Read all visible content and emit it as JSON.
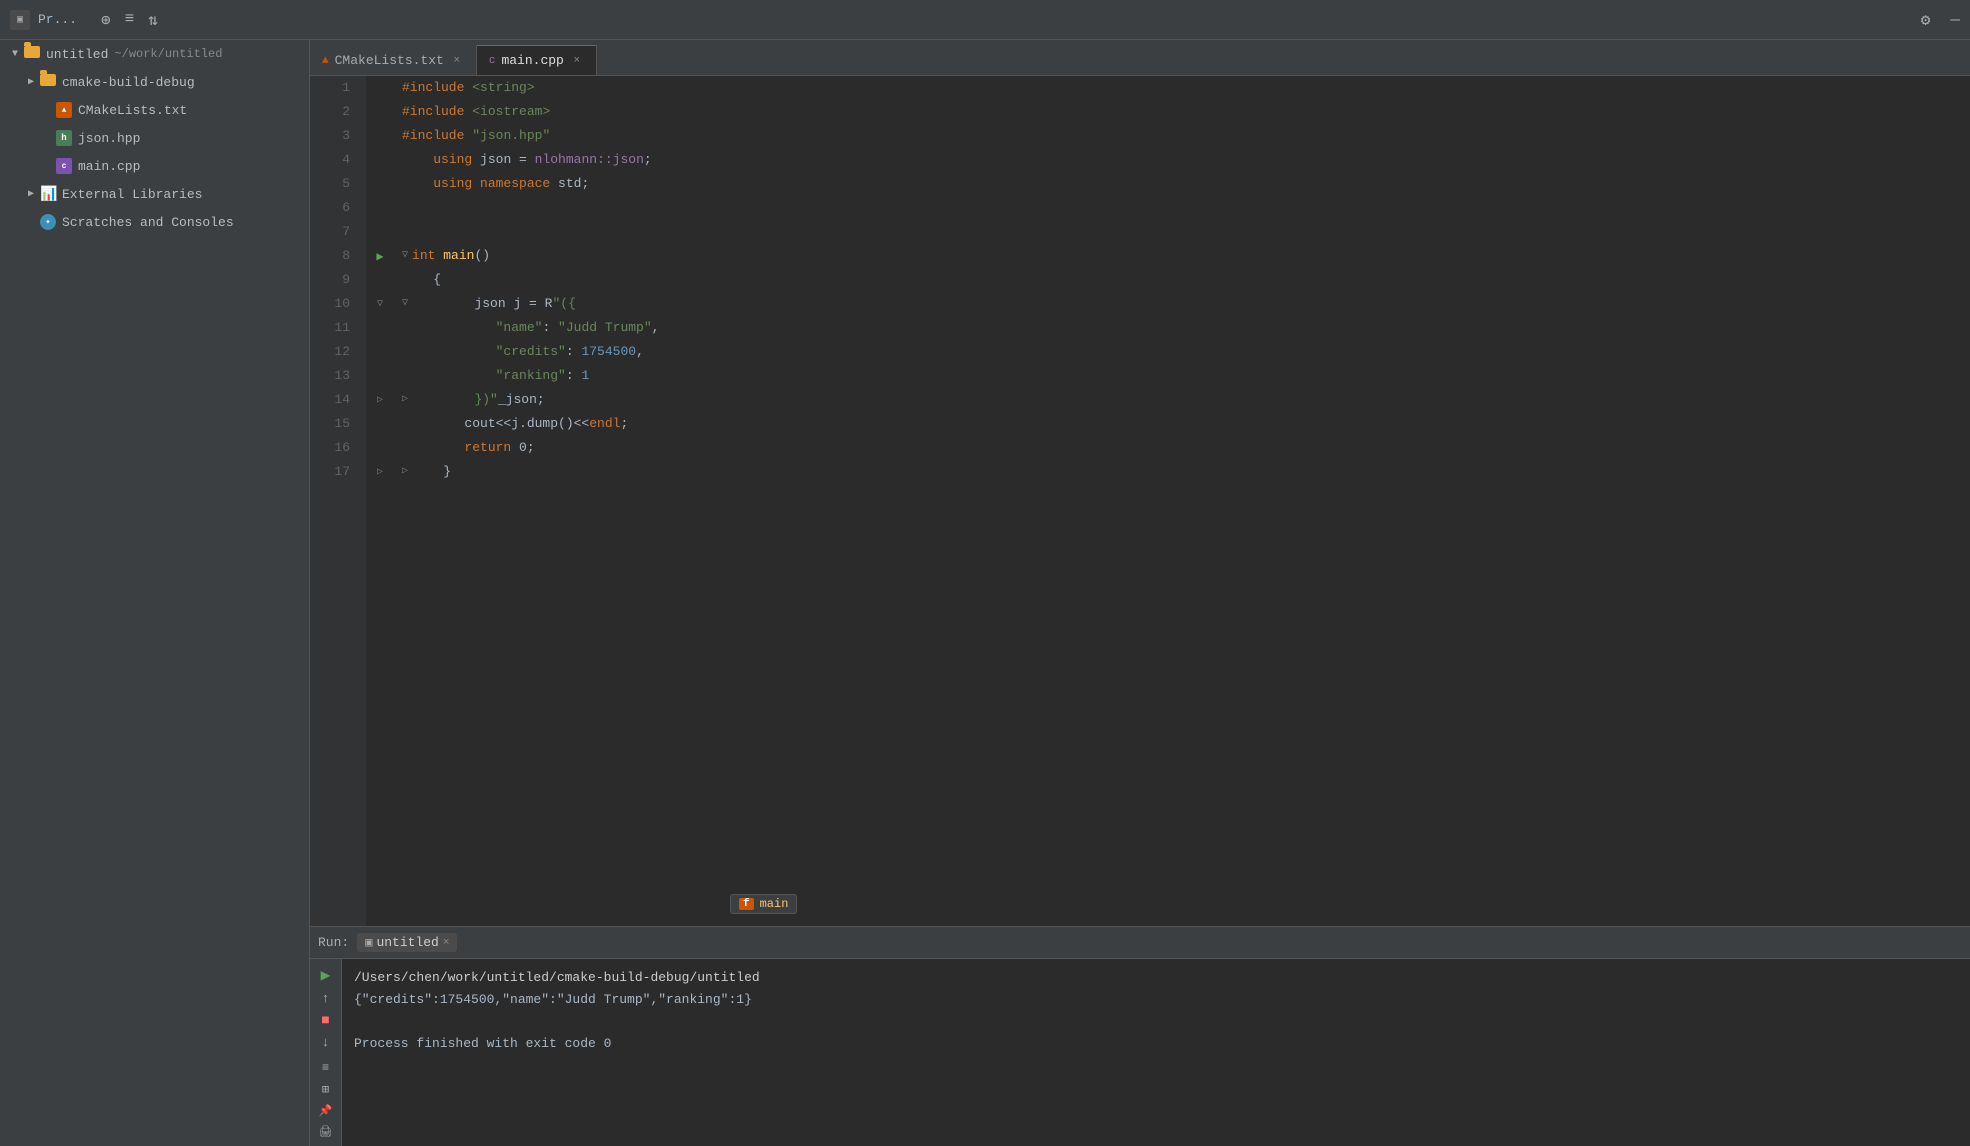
{
  "titlebar": {
    "icon": "▣",
    "title": "Pr...",
    "actions": [
      "⊕",
      "≡",
      "⇅",
      "⚙",
      "—"
    ],
    "settings_label": "⚙",
    "minimize_label": "—"
  },
  "tabs": [
    {
      "id": "cmake",
      "label": "CMakeLists.txt",
      "active": false,
      "close": "×"
    },
    {
      "id": "main",
      "label": "main.cpp",
      "active": true,
      "close": "×"
    }
  ],
  "sidebar": {
    "items": [
      {
        "id": "untitled-root",
        "label": "untitled",
        "sublabel": "~/work/untitled",
        "level": 0,
        "expanded": true,
        "type": "folder"
      },
      {
        "id": "cmake-build-debug",
        "label": "cmake-build-debug",
        "level": 1,
        "expanded": false,
        "type": "folder"
      },
      {
        "id": "cmakelists",
        "label": "CMakeLists.txt",
        "level": 2,
        "type": "cmake"
      },
      {
        "id": "json-hpp",
        "label": "json.hpp",
        "level": 2,
        "type": "h"
      },
      {
        "id": "main-cpp",
        "label": "main.cpp",
        "level": 2,
        "type": "cpp"
      },
      {
        "id": "external-libs",
        "label": "External Libraries",
        "level": 1,
        "expanded": false,
        "type": "extlibs"
      },
      {
        "id": "scratches",
        "label": "Scratches and Consoles",
        "level": 1,
        "type": "scratches"
      }
    ]
  },
  "code": {
    "lines": [
      {
        "num": 1,
        "content": "#include <string>",
        "tokens": [
          {
            "t": "inc",
            "v": "#include"
          },
          {
            "t": "plain",
            "v": " "
          },
          {
            "t": "str",
            "v": "<string>"
          }
        ]
      },
      {
        "num": 2,
        "content": "#include <iostream>",
        "tokens": [
          {
            "t": "inc",
            "v": "#include"
          },
          {
            "t": "plain",
            "v": " "
          },
          {
            "t": "str",
            "v": "<iostream>"
          }
        ]
      },
      {
        "num": 3,
        "content": "#include \"json.hpp\"",
        "tokens": [
          {
            "t": "inc",
            "v": "#include"
          },
          {
            "t": "plain",
            "v": " "
          },
          {
            "t": "str",
            "v": "\"json.hpp\""
          }
        ]
      },
      {
        "num": 4,
        "content": "    using json = nlohmann::json;",
        "tokens": [
          {
            "t": "plain",
            "v": "    "
          },
          {
            "t": "kw",
            "v": "using"
          },
          {
            "t": "plain",
            "v": " json = "
          },
          {
            "t": "ns",
            "v": "nlohmann::json"
          },
          {
            "t": "plain",
            "v": ";"
          }
        ]
      },
      {
        "num": 5,
        "content": "    using namespace std;",
        "tokens": [
          {
            "t": "plain",
            "v": "    "
          },
          {
            "t": "kw",
            "v": "using namespace"
          },
          {
            "t": "plain",
            "v": " std;"
          }
        ]
      },
      {
        "num": 6,
        "content": "",
        "tokens": []
      },
      {
        "num": 7,
        "content": "",
        "tokens": []
      },
      {
        "num": 8,
        "content": "int main()",
        "tokens": [
          {
            "t": "kw",
            "v": "int"
          },
          {
            "t": "plain",
            "v": " "
          },
          {
            "t": "fn",
            "v": "main"
          },
          {
            "t": "plain",
            "v": "()"
          }
        ],
        "has_play": true,
        "foldable": true
      },
      {
        "num": 9,
        "content": "    {",
        "tokens": [
          {
            "t": "plain",
            "v": "    {"
          }
        ]
      },
      {
        "num": 10,
        "content": "        json j = R\"({",
        "tokens": [
          {
            "t": "plain",
            "v": "        json j = R"
          },
          {
            "t": "str",
            "v": "\"({"
          }
        ],
        "foldable": true
      },
      {
        "num": 11,
        "content": "            \"name\": \"Judd Trump\",",
        "tokens": [
          {
            "t": "plain",
            "v": "            "
          },
          {
            "t": "str-key",
            "v": "\"name\""
          },
          {
            "t": "plain",
            "v": ": "
          },
          {
            "t": "str",
            "v": "\"Judd Trump\""
          },
          {
            "t": "plain",
            "v": ","
          }
        ]
      },
      {
        "num": 12,
        "content": "            \"credits\": 1754500,",
        "tokens": [
          {
            "t": "plain",
            "v": "            "
          },
          {
            "t": "str-key",
            "v": "\"credits\""
          },
          {
            "t": "plain",
            "v": ": "
          },
          {
            "t": "num",
            "v": "1754500"
          },
          {
            "t": "plain",
            "v": ","
          }
        ]
      },
      {
        "num": 13,
        "content": "            \"ranking\": 1",
        "tokens": [
          {
            "t": "plain",
            "v": "            "
          },
          {
            "t": "str-key",
            "v": "\"ranking\""
          },
          {
            "t": "plain",
            "v": ": "
          },
          {
            "t": "num",
            "v": "1"
          }
        ]
      },
      {
        "num": 14,
        "content": "        })\"_json;",
        "tokens": [
          {
            "t": "plain",
            "v": "        "
          },
          {
            "t": "str",
            "v": "})\""
          },
          {
            "t": "plain",
            "v": "_json;"
          }
        ],
        "foldable": true
      },
      {
        "num": 15,
        "content": "        cout<<j.dump()<<endl;",
        "tokens": [
          {
            "t": "plain",
            "v": "        cout<<j.dump()<<"
          },
          {
            "t": "kw",
            "v": "endl"
          },
          {
            "t": "plain",
            "v": ";"
          }
        ]
      },
      {
        "num": 16,
        "content": "        return 0;",
        "tokens": [
          {
            "t": "plain",
            "v": "        "
          },
          {
            "t": "kw",
            "v": "return"
          },
          {
            "t": "plain",
            "v": " 0;"
          }
        ]
      },
      {
        "num": 17,
        "content": "    }",
        "tokens": [
          {
            "t": "plain",
            "v": "    }"
          }
        ],
        "foldable": true
      }
    ],
    "fn_hint": {
      "badge": "f",
      "name": "main"
    }
  },
  "run_panel": {
    "label": "Run:",
    "tab_label": "untitled",
    "tab_close": "×",
    "output_lines": [
      {
        "text": "/Users/chen/work/untitled/cmake-build-debug/untitled",
        "type": "path"
      },
      {
        "text": "{\"credits\":1754500,\"name\":\"Judd Trump\",\"ranking\":1}",
        "type": "success"
      },
      {
        "text": "",
        "type": "blank"
      },
      {
        "text": "Process finished with exit code 0",
        "type": "finish"
      }
    ],
    "toolbar": {
      "play": "▶",
      "up": "↑",
      "stop": "■",
      "down": "↓",
      "tabs1": "≡",
      "tabs2": "⊞",
      "pin": "📌",
      "print": "🖨"
    }
  }
}
